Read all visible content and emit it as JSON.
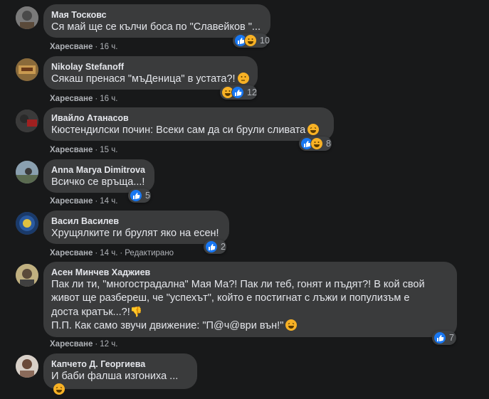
{
  "comments": [
    {
      "author": "Мая Тосковс",
      "text": "Ся май ще се кълчи боса по \"Славейков \"...",
      "like_label": "Харесване",
      "time": "16 ч.",
      "reaction_count": "10",
      "reaction_icons": [
        "like-icon",
        "haha-icon"
      ]
    },
    {
      "author": "Nikolay Stefanoff",
      "text": "Сякаш пренася \"мъДеница\" в устата?!",
      "trailing_emoji": "thinking-face-icon",
      "like_label": "Харесване",
      "time": "16 ч.",
      "reaction_count": "12",
      "reaction_icons": [
        "haha-icon",
        "like-icon"
      ]
    },
    {
      "author": "Ивайло Атанасов",
      "text": "Кюстендилски почин: Всеки сам да си брули сливата",
      "trailing_emoji": "grinning-face-icon",
      "like_label": "Харесване",
      "time": "15 ч.",
      "reaction_count": "8",
      "reaction_icons": [
        "like-icon",
        "haha-icon"
      ]
    },
    {
      "author": "Anna Marya Dimitrova",
      "text": "Всичко се връща...!",
      "like_label": "Харесване",
      "time": "14 ч.",
      "reaction_count": "5",
      "reaction_icons": [
        "like-icon"
      ]
    },
    {
      "author": "Васил Василев",
      "text": "Хрущялките ги брулят яко на есен!",
      "like_label": "Харесване",
      "time": "14 ч.",
      "edited_label": "Редактирано",
      "reaction_count": "2",
      "reaction_icons": [
        "like-icon"
      ]
    },
    {
      "author": "Асен Минчев Хаджиев",
      "text_lines": [
        "Пак ли ти, \"многострадална\" Мая Ма?! Пак ли теб, гонят и пъдят?! В кой свой",
        "живот ще разбереш, че \"успехът\", който е постигнат с лъжи и популизъм е",
        "доста кратък...?!"
      ],
      "text_line4": "П.П. Как само звучи движение: \"П@ч@ври вън!\"",
      "like_label": "Харесване",
      "time": "12 ч.",
      "reaction_count": "7",
      "reaction_icons": [
        "like-icon"
      ]
    },
    {
      "author": "Капчето Д. Георгиева",
      "text": "И баби фалша изгониха ...",
      "trailing_emoji": "grinning-face-icon"
    }
  ],
  "colors": {
    "background": "#18191a",
    "bubble": "#3a3b3c",
    "like_blue": "#1877f2",
    "haha_yellow": "#f7b125"
  }
}
